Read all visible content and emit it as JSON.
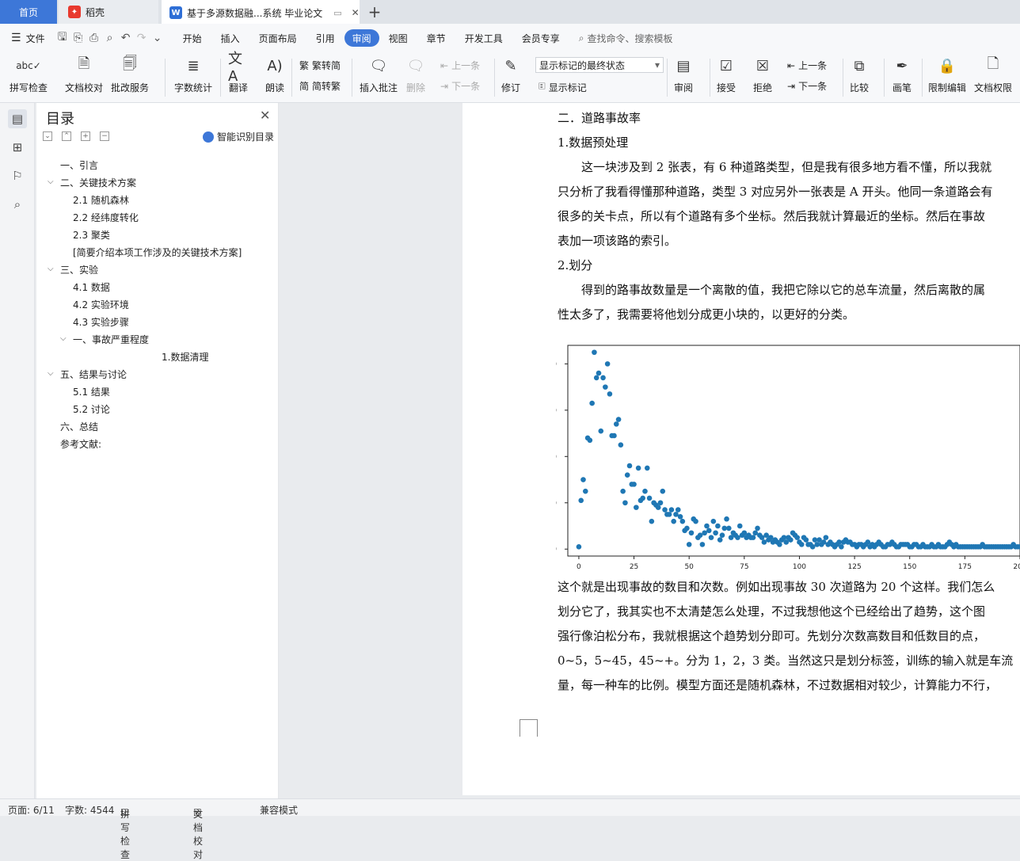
{
  "tabs": {
    "home": "首页",
    "daoke": "稻壳",
    "doc": "基于多源数据融...系统 毕业论文"
  },
  "menubar": {
    "file": "文件",
    "items": [
      "开始",
      "插入",
      "页面布局",
      "引用",
      "审阅",
      "视图",
      "章节",
      "开发工具",
      "会员专享"
    ],
    "active": "审阅",
    "search": "查找命令、搜索模板"
  },
  "ribbon": {
    "spell": "拼写检查",
    "proof": "文档校对",
    "review_service": "批改服务",
    "wordcount": "字数统计",
    "translate": "翻译",
    "read": "朗读",
    "trad": "繁转简",
    "simp": "简转繁",
    "insert_comment": "插入批注",
    "delete": "删除",
    "prev": "上一条",
    "next": "下一条",
    "track": "修订",
    "markup_select": "显示标记的最终状态",
    "show_markup": "显示标记",
    "review": "审阅",
    "accept": "接受",
    "reject": "拒绝",
    "prev2": "上一条",
    "next2": "下一条",
    "compare": "比较",
    "pen": "画笔",
    "restrict": "限制编辑",
    "doc_perm": "文档权限"
  },
  "toc": {
    "title": "目录",
    "smart": "智能识别目录",
    "items": [
      "一、引言",
      "二、关键技术方案",
      "2.1 随机森林",
      "2.2 经纬度转化",
      "2.3 聚类",
      "[简要介绍本项工作涉及的关键技术方案]",
      "三、实验",
      "4.1 数据",
      "4.2 实验环境",
      "4.3 实验步骤",
      "一、事故严重程度",
      "1.数据清理",
      "五、结果与讨论",
      "5.1 结果",
      "5.2 讨论",
      "六、总结",
      "参考文献:"
    ]
  },
  "doc": {
    "h_section": "二．道路事故率",
    "h1": "1.数据预处理",
    "p1": [
      "这一块涉及到 2 张表，有 6 种道路类型，但是我有很多地方看不懂，所以我就",
      "只分析了我看得懂那种道路，类型 3 对应另外一张表是 A 开头。他同一条道路会有",
      "很多的关卡点，所以有个道路有多个坐标。然后我就计算最近的坐标。然后在事故",
      "表加一项该路的索引。"
    ],
    "h2": "2.划分",
    "p2": [
      "得到的路事故数量是一个离散的值，我把它除以它的总车流量，然后离散的属",
      "性太多了，我需要将他划分成更小块的，以更好的分类。"
    ],
    "p3": [
      "这个就是出现事故的数目和次数。例如出现事故 30 次道路为 20 个这样。我们怎么",
      "划分它了，我其实也不太清楚怎么处理，不过我想他这个已经给出了趋势，这个图",
      "强行像泊松分布，我就根据这个趋势划分即可。先划分次数高数目和低数目的点，",
      "0~5，5~45，45~+。分为 1，2，3 类。当然这只是划分标签，训练的输入就是车流",
      "量，每一种车的比例。模型方面还是随机森林，不过数据相对较少，计算能力不行，"
    ]
  },
  "chart_data": {
    "type": "scatter",
    "xlim": [
      -5,
      200
    ],
    "ylim": [
      -3,
      88
    ],
    "xticks": [
      0,
      25,
      50,
      75,
      100,
      125,
      150,
      175,
      200
    ],
    "yticks": [
      0,
      20,
      40,
      60,
      80
    ],
    "color": "#1f77b4",
    "x": [
      0,
      1,
      2,
      3,
      4,
      5,
      6,
      7,
      8,
      9,
      10,
      11,
      12,
      13,
      14,
      15,
      16,
      17,
      18,
      19,
      20,
      21,
      22,
      23,
      24,
      25,
      26,
      27,
      28,
      29,
      30,
      31,
      32,
      33,
      34,
      35,
      36,
      37,
      38,
      39,
      40,
      41,
      42,
      43,
      44,
      45,
      46,
      47,
      48,
      49,
      50,
      51,
      52,
      53,
      54,
      55,
      56,
      57,
      58,
      59,
      60,
      61,
      62,
      63,
      64,
      65,
      66,
      67,
      68,
      69,
      70,
      71,
      72,
      73,
      74,
      75,
      76,
      77,
      78,
      79,
      80,
      81,
      82,
      83,
      84,
      85,
      86,
      87,
      88,
      89,
      90,
      91,
      92,
      93,
      94,
      95,
      96,
      97,
      98,
      99,
      100,
      101,
      102,
      103,
      104,
      105,
      106,
      107,
      108,
      109,
      110,
      111,
      112,
      113,
      114,
      115,
      116,
      117,
      118,
      119,
      120,
      121,
      122,
      123,
      124,
      125,
      126,
      127,
      128,
      129,
      130,
      131,
      132,
      133,
      134,
      135,
      136,
      137,
      138,
      139,
      140,
      141,
      142,
      143,
      144,
      145,
      146,
      147,
      148,
      149,
      150,
      151,
      152,
      153,
      154,
      155,
      156,
      157,
      158,
      159,
      160,
      161,
      162,
      163,
      164,
      165,
      166,
      167,
      168,
      169,
      170,
      171,
      172,
      173,
      174,
      175,
      176,
      177,
      178,
      179,
      180,
      181,
      182,
      183,
      184,
      185,
      186,
      187,
      188,
      189,
      190,
      191,
      192,
      193,
      194,
      195,
      196,
      197,
      198,
      199,
      200
    ],
    "y": [
      1,
      21,
      30,
      25,
      48,
      47,
      63,
      85,
      74,
      76,
      51,
      74,
      70,
      80,
      67,
      49,
      49,
      54,
      56,
      45,
      25,
      20,
      32,
      36,
      28,
      28,
      18,
      35,
      21,
      22,
      25,
      35,
      22,
      12,
      20,
      19,
      18,
      20,
      25,
      17,
      15,
      15,
      17,
      12,
      15,
      17,
      14,
      12,
      8,
      9,
      2,
      7,
      13,
      12,
      5,
      6,
      2,
      7,
      10,
      8,
      5,
      12,
      7,
      10,
      4,
      6,
      9,
      13,
      9,
      5,
      7,
      6,
      5,
      10,
      6,
      7,
      5,
      6,
      5,
      5,
      7,
      9,
      6,
      5,
      3,
      6,
      4,
      5,
      3,
      4,
      3,
      2,
      4,
      5,
      3,
      5,
      4,
      7,
      6,
      5,
      3,
      2,
      5,
      4,
      2,
      2,
      1,
      4,
      2,
      4,
      2,
      3,
      5,
      2,
      3,
      2,
      1,
      2,
      3,
      1,
      3,
      4,
      3,
      3,
      2,
      2,
      1,
      2,
      2,
      1,
      2,
      3,
      1,
      2,
      1,
      2,
      3,
      2,
      1,
      1,
      2,
      2,
      3,
      2,
      1,
      1,
      2,
      2,
      2,
      2,
      1,
      1,
      2,
      2,
      1,
      1,
      2,
      1,
      1,
      1,
      2,
      1,
      1,
      2,
      1,
      1,
      1,
      2,
      3,
      2,
      1,
      2,
      1,
      1,
      1,
      1,
      1,
      1,
      1,
      1,
      1,
      1,
      1,
      2,
      1,
      1,
      1,
      1,
      1,
      1,
      1,
      1,
      1,
      1,
      1,
      1,
      1,
      2,
      1,
      1,
      1
    ]
  },
  "status": {
    "page": "页面: 6/11",
    "words": "字数: 4544",
    "spell": "拼写检查",
    "proof": "文档校对",
    "compat": "兼容模式"
  }
}
